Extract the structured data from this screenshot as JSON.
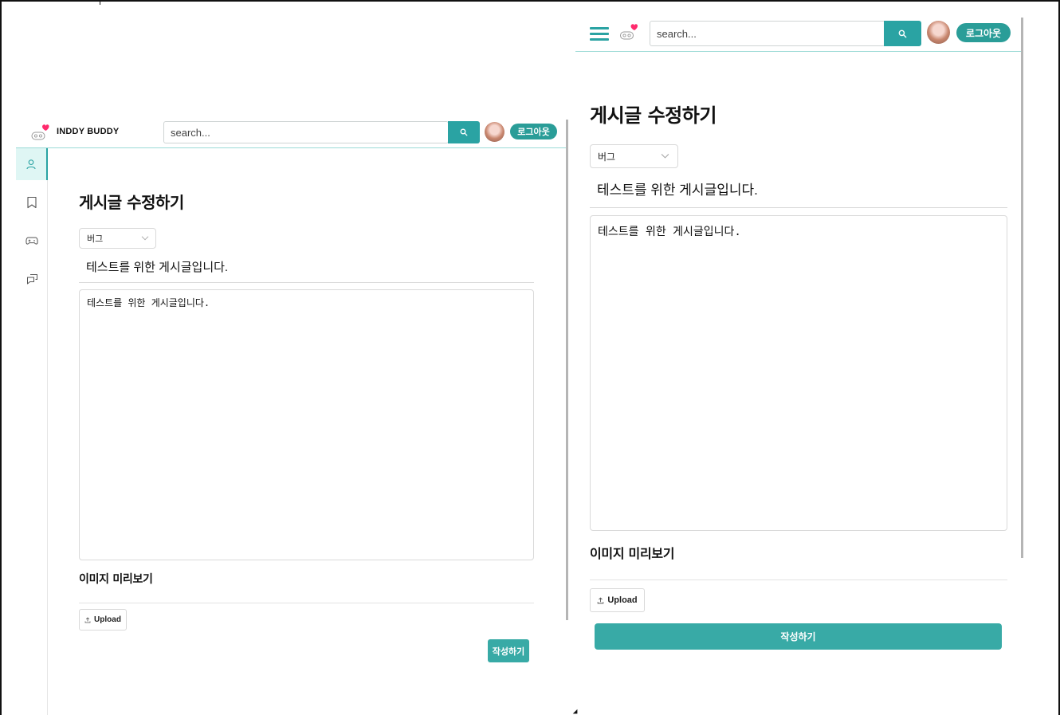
{
  "colors": {
    "accent": "#2aa3a3",
    "button": "#38aaa6",
    "header_line": "#9bdad6",
    "heart": "#ff2a6d"
  },
  "desktop": {
    "brand": "INDDY BUDDY",
    "search": {
      "placeholder": "search..."
    },
    "logout_label": "로그아웃",
    "sidebar": {
      "items": [
        {
          "icon": "user-icon",
          "active": true
        },
        {
          "icon": "bookmark-icon",
          "active": false
        },
        {
          "icon": "gamepad-icon",
          "active": false
        },
        {
          "icon": "chat-icon",
          "active": false
        }
      ]
    },
    "page_title": "게시글 수정하기",
    "category": {
      "selected": "버그"
    },
    "post_title": "테스트를 위한 게시글입니다.",
    "post_body": "테스트를 위한 게시글입니다.",
    "image_preview_label": "이미지 미리보기",
    "upload_label": "Upload",
    "submit_label": "작성하기"
  },
  "mobile": {
    "search": {
      "placeholder": "search..."
    },
    "logout_label": "로그아웃",
    "page_title": "게시글 수정하기",
    "category": {
      "selected": "버그"
    },
    "post_title": "테스트를 위한 게시글입니다.",
    "post_body": "테스트를 위한 게시글입니다.",
    "image_preview_label": "이미지 미리보기",
    "upload_label": "Upload",
    "submit_label": "작성하기"
  }
}
